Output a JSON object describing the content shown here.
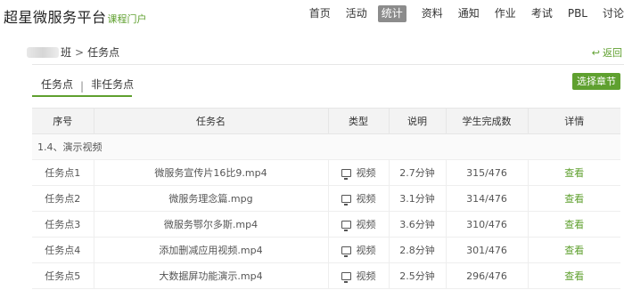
{
  "header": {
    "title": "超星微服务平台",
    "subtitle": "课程门户",
    "nav": [
      "首页",
      "活动",
      "统计",
      "资料",
      "通知",
      "作业",
      "考试",
      "PBL",
      "讨论"
    ],
    "active_nav": "统计"
  },
  "breadcrumb": {
    "class_suffix": "班",
    "current": "任务点"
  },
  "back_label": "返回",
  "tabs": {
    "task": "任务点",
    "non_task": "非任务点"
  },
  "select_chapter_label": "选择章节",
  "table": {
    "headers": [
      "序号",
      "任务名",
      "类型",
      "说明",
      "学生完成数",
      "详情"
    ],
    "section": "1.4、演示视频",
    "rows": [
      {
        "no": "任务点1",
        "name": "微服务宣传片16比9.mp4",
        "type": "视频",
        "desc": "2.7分钟",
        "done": "315/476",
        "detail": "查看"
      },
      {
        "no": "任务点2",
        "name": "微服务理念篇.mpg",
        "type": "视频",
        "desc": "3.1分钟",
        "done": "314/476",
        "detail": "查看"
      },
      {
        "no": "任务点3",
        "name": "微服务鄂尔多斯.mp4",
        "type": "视频",
        "desc": "3.6分钟",
        "done": "310/476",
        "detail": "查看"
      },
      {
        "no": "任务点4",
        "name": "添加删减应用视频.mp4",
        "type": "视频",
        "desc": "2.8分钟",
        "done": "301/476",
        "detail": "查看"
      },
      {
        "no": "任务点5",
        "name": "大数据屏功能演示.mp4",
        "type": "视频",
        "desc": "2.5分钟",
        "done": "296/476",
        "detail": "查看"
      }
    ]
  },
  "colors": {
    "accent": "#5fa02f",
    "active_nav_bg": "#8c8c8c",
    "table_header_bg": "#f3f3f3"
  }
}
